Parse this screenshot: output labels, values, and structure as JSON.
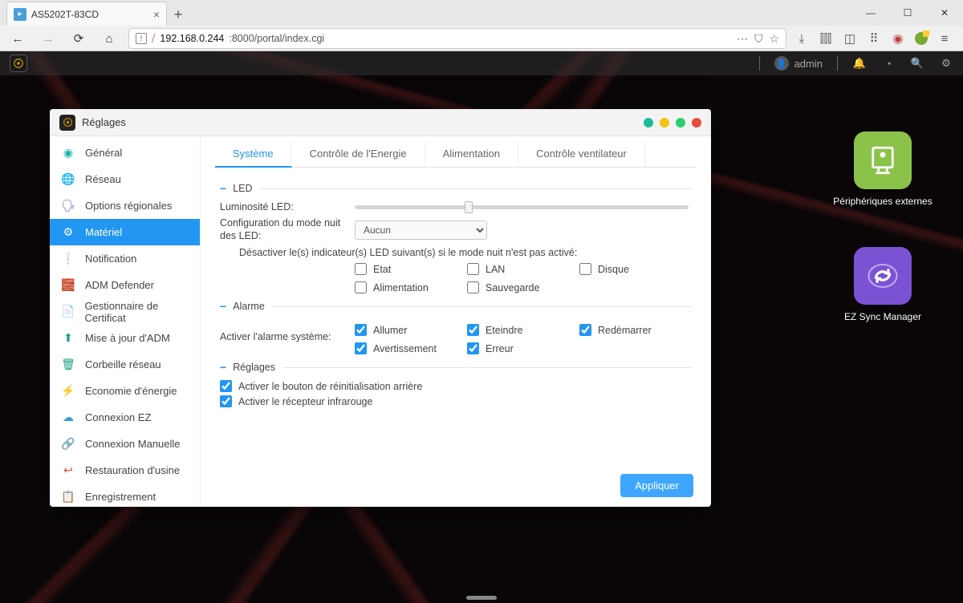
{
  "browser": {
    "tab_title": "AS5202T-83CD",
    "url_display": "192.168.0.244:8000/portal/index.cgi",
    "url_host": "192.168.0.244",
    "url_port_path": ":8000/portal/index.cgi"
  },
  "topbar": {
    "username": "admin"
  },
  "desktop": {
    "icon1": {
      "label": "Périphériques externes"
    },
    "icon2": {
      "label": "EZ Sync Manager"
    }
  },
  "window": {
    "title": "Réglages",
    "sidebar": {
      "items": [
        {
          "label": "Général"
        },
        {
          "label": "Réseau"
        },
        {
          "label": "Options régionales"
        },
        {
          "label": "Matériel"
        },
        {
          "label": "Notification"
        },
        {
          "label": "ADM Defender"
        },
        {
          "label": "Gestionnaire de Certificat"
        },
        {
          "label": "Mise à jour d'ADM"
        },
        {
          "label": "Corbeille réseau"
        },
        {
          "label": "Economie d'énergie"
        },
        {
          "label": "Connexion EZ"
        },
        {
          "label": "Connexion Manuelle"
        },
        {
          "label": "Restauration d'usine"
        },
        {
          "label": "Enregistrement"
        }
      ],
      "active_index": 3
    },
    "tabs": {
      "items": [
        "Système",
        "Contrôle de l'Energie",
        "Alimentation",
        "Contrôle ventilateur"
      ],
      "active_index": 0
    },
    "sections": {
      "led": {
        "title": "LED",
        "brightness_label": "Luminosité LED:",
        "night_label": "Configuration du mode nuit des LED:",
        "night_value": "Aucun",
        "disable_note": "Désactiver le(s) indicateur(s) LED suivant(s) si le mode nuit n'est pas activé:",
        "chk": {
          "etat": "Etat",
          "lan": "LAN",
          "disque": "Disque",
          "alim": "Alimentation",
          "sauvegarde": "Sauvegarde"
        }
      },
      "alarme": {
        "title": "Alarme",
        "activate_label": "Activer l'alarme système:",
        "chk": {
          "allumer": "Allumer",
          "eteindre": "Eteindre",
          "redemarrer": "Redémarrer",
          "avert": "Avertissement",
          "erreur": "Erreur"
        }
      },
      "reglages": {
        "title": "Réglages",
        "reset_btn": "Activer le bouton de réinitialisation arrière",
        "ir": "Activer le récepteur infrarouge"
      }
    },
    "apply": "Appliquer"
  }
}
